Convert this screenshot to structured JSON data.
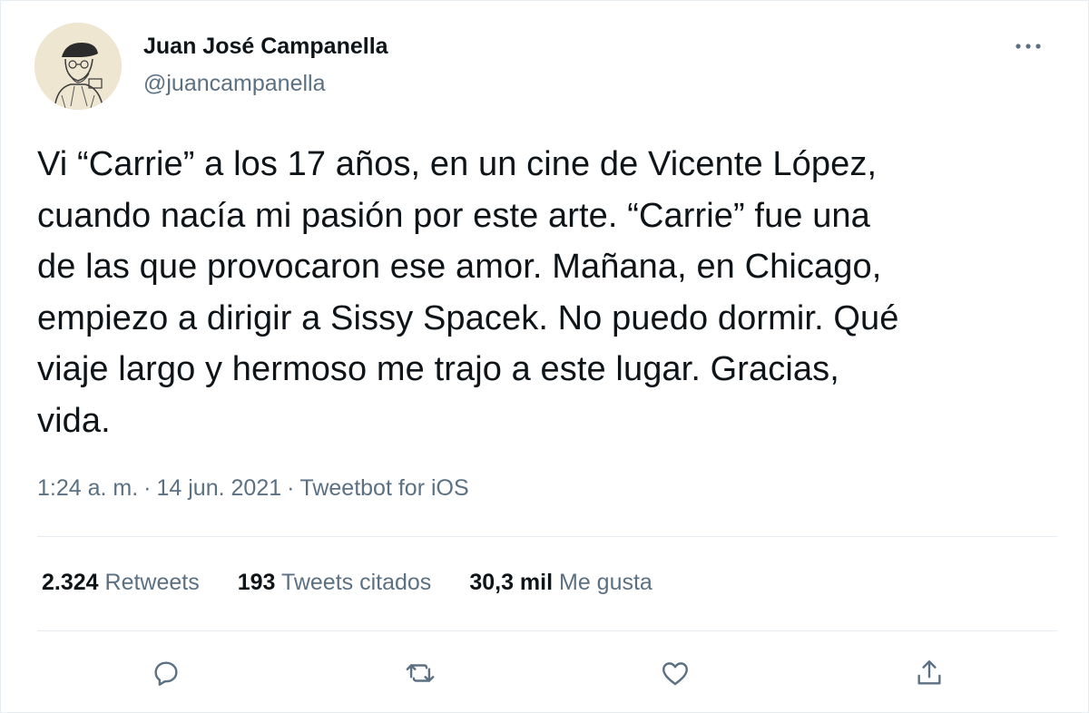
{
  "author": {
    "name": "Juan José Campanella",
    "handle": "@juancampanella"
  },
  "tweet": {
    "text": "Vi “Carrie” a los 17 años, en un cine de Vicente López,\ncuando nacía mi pasión por este arte. “Carrie” fue una\nde las que provocaron ese amor. Mañana, en Chicago,\nempiezo a dirigir a Sissy Spacek. No puedo dormir. Qué\nviaje largo y hermoso me trajo a este lugar. Gracias,\nvida.",
    "time": "1:24 a. m.",
    "date": "14 jun. 2021",
    "separator": "·",
    "source": "Tweetbot for iOS"
  },
  "stats": {
    "retweets_count": "2.324",
    "retweets_label": "Retweets",
    "quotes_count": "193",
    "quotes_label": "Tweets citados",
    "likes_count": "30,3 mil",
    "likes_label": "Me gusta"
  },
  "icons": {
    "more": "more-horizontal-icon",
    "reply": "reply-icon",
    "retweet": "retweet-icon",
    "like": "heart-icon",
    "share": "share-icon"
  },
  "colors": {
    "text": "#0f1419",
    "secondary": "#5b7083",
    "divider": "#e6ecf0",
    "icon": "#5b7083"
  }
}
